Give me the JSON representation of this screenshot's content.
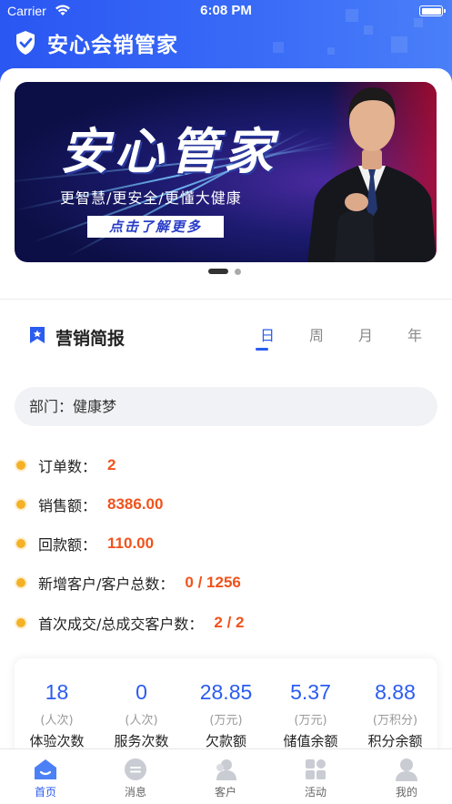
{
  "status_bar": {
    "carrier": "Carrier",
    "time": "6:08 PM"
  },
  "app": {
    "title": "安心会销管家",
    "accent": "#2b5cf0",
    "value_color": "#f0531c"
  },
  "banner": {
    "title": "安心管家",
    "subtitle": "更智慧/更安全/更懂大健康",
    "cta": "点击了解更多",
    "page_index": 1,
    "page_count": 2
  },
  "section": {
    "title": "营销简报",
    "tabs": [
      {
        "label": "日",
        "active": true
      },
      {
        "label": "周",
        "active": false
      },
      {
        "label": "月",
        "active": false
      },
      {
        "label": "年",
        "active": false
      }
    ]
  },
  "department": "部门：健康梦",
  "stats": [
    {
      "label": "订单数：",
      "value": "2"
    },
    {
      "label": "销售额：",
      "value": "8386.00"
    },
    {
      "label": "回款额：",
      "value": "110.00"
    },
    {
      "label": "新增客户/客户总数：",
      "value": "0 / 1256"
    },
    {
      "label": "首次成交/总成交客户数：",
      "value": "2 / 2"
    }
  ],
  "metrics": [
    {
      "value": "18",
      "unit": "(人次)",
      "label": "体验次数"
    },
    {
      "value": "0",
      "unit": "(人次)",
      "label": "服务次数"
    },
    {
      "value": "28.85",
      "unit": "(万元)",
      "label": "欠款额"
    },
    {
      "value": "5.37",
      "unit": "(万元)",
      "label": "储值余额"
    },
    {
      "value": "8.88",
      "unit": "(万积分)",
      "label": "积分余额"
    }
  ],
  "tabbar": [
    {
      "label": "首页",
      "icon": "home-icon",
      "active": true
    },
    {
      "label": "消息",
      "icon": "message-icon",
      "active": false
    },
    {
      "label": "客户",
      "icon": "customer-icon",
      "active": false
    },
    {
      "label": "活动",
      "icon": "activity-icon",
      "active": false
    },
    {
      "label": "我的",
      "icon": "profile-icon",
      "active": false
    }
  ]
}
